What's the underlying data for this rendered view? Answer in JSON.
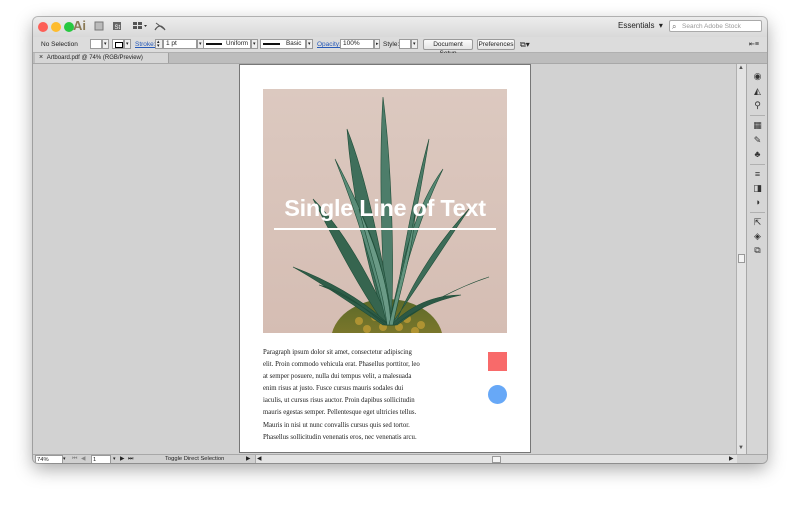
{
  "app": {
    "logo": "Ai",
    "workspace": "Essentials",
    "stock_search_placeholder": "Search Adobe Stock"
  },
  "control_bar": {
    "selection": "No Selection",
    "stroke_label": "Stroke:",
    "stroke_value": "1 pt",
    "profile_label": "Uniform",
    "brush_label": "Basic",
    "opacity_label": "Opacity:",
    "opacity_value": "100%",
    "style_label": "Style:",
    "document_setup": "Document Setup",
    "preferences": "Preferences"
  },
  "tab": {
    "close": "×",
    "title": "Artboard.pdf @ 74% (RGB/Preview)"
  },
  "artboard": {
    "headline": "Single Line of Text",
    "paragraph_lines": [
      "Paragraph ipsum dolor sit amet, consectetur adipiscing",
      "elit. Proin commodo vehicula erat. Phasellus porttitor, leo",
      "at semper posuere, nulla dui tempus velit, a malesuada",
      "enim risus at justo. Fusce cursus mauris sodales dui",
      "iaculis, ut cursus risus auctor. Proin dapibus sollicitudin",
      "mauris egestas semper. Pellentesque eget ultricies tellus.",
      "Mauris in nisi ut nunc convallis cursus quis sed tortor.",
      "Phasellus sollicitudin venenatis eros, nec venenatis arcu."
    ],
    "square_color": "#f86a6a",
    "circle_color": "#67a8f7"
  },
  "status_bar": {
    "zoom": "74%",
    "artboard_number": "1",
    "tool_status": "Toggle Direct Selection"
  },
  "colors": {
    "close": "#fd5f57",
    "minimize": "#febc2e",
    "maximize": "#27c840"
  }
}
